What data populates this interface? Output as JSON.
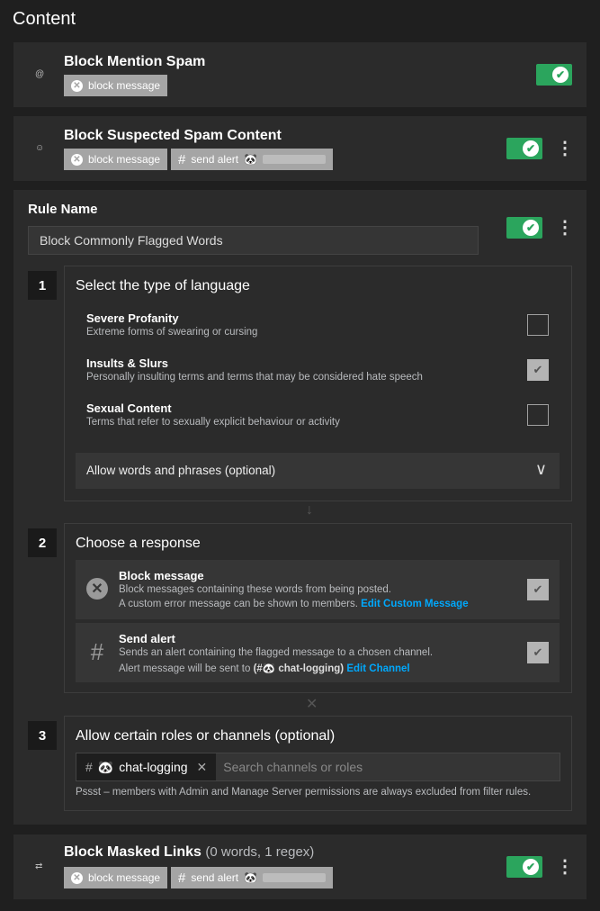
{
  "section_title": "Content",
  "rules": {
    "mention_spam": {
      "name": "Block Mention Spam",
      "tag_block": "block message"
    },
    "suspected_spam": {
      "name": "Block Suspected Spam Content",
      "tag_block": "block message",
      "tag_alert": "send alert"
    },
    "masked_links": {
      "name": "Block Masked Links",
      "meta": "(0 words, 1 regex)",
      "tag_block": "block message",
      "tag_alert": "send alert"
    }
  },
  "editor": {
    "rule_name_label": "Rule Name",
    "rule_name_value": "Block Commonly Flagged Words",
    "step1": {
      "number": "1",
      "title": "Select the type of language",
      "options": [
        {
          "title": "Severe Profanity",
          "desc": "Extreme forms of swearing or cursing",
          "checked": false
        },
        {
          "title": "Insults & Slurs",
          "desc": "Personally insulting terms and terms that may be considered hate speech",
          "checked": true
        },
        {
          "title": "Sexual Content",
          "desc": "Terms that refer to sexually explicit behaviour or activity",
          "checked": false
        }
      ],
      "allow_words": "Allow words and phrases (optional)"
    },
    "step2": {
      "number": "2",
      "title": "Choose a response",
      "block": {
        "title": "Block message",
        "line1": "Block messages containing these words from being posted.",
        "line2": "A custom error message can be shown to members.",
        "link": "Edit Custom Message"
      },
      "alert": {
        "title": "Send alert",
        "line1": "Sends an alert containing the flagged message to a chosen channel.",
        "line2_prefix": "Alert message will be sent to",
        "line2_channel": "(#🐼 chat-logging)",
        "link": "Edit Channel"
      }
    },
    "step3": {
      "number": "3",
      "title": "Allow certain roles or channels (optional)",
      "chip": "chat-logging",
      "search_placeholder": "Search channels or roles",
      "note": "Pssst – members with Admin and Manage Server permissions are always excluded from filter rules."
    }
  },
  "icons": {
    "close": "✕",
    "hash": "#",
    "check": "✔",
    "chevron": "∨",
    "kebab": "⋮",
    "arrow_down": "↓",
    "connector_x": "✕",
    "panda": "🐼"
  },
  "colors": {
    "toggle_on": "#2ba55d",
    "link": "#00a8fc",
    "tag": "#a5a5a5"
  }
}
